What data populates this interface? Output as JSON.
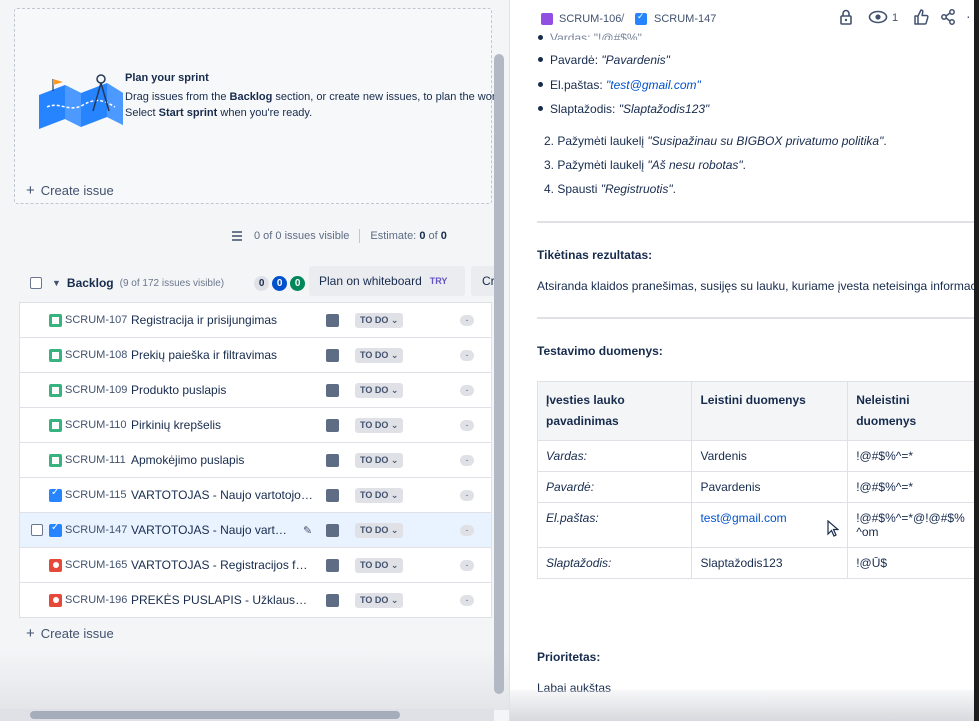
{
  "sprint_empty": {
    "title": "Plan your sprint",
    "line1_a": "Drag issues from the ",
    "line1_b": "Backlog",
    "line1_c": " section, or create new issues, to plan the work for",
    "line2_a": "Select ",
    "line2_b": "Start sprint",
    "line2_c": " when you're ready."
  },
  "create_issue_label": "Create issue",
  "stats": {
    "visible": "0 of 0 issues visible",
    "estimate_label": "Estimate:",
    "estimate_a": "0",
    "estimate_of": " of ",
    "estimate_b": "0"
  },
  "backlog": {
    "name": "Backlog",
    "count": "(9 of 172 issues visible)",
    "pill_grey": "0",
    "pill_blue": "0",
    "pill_green": "0",
    "plan_btn": "Plan on whiteboard",
    "plan_try": "TRY",
    "create_sprint_btn": "Cr",
    "status_label": "TO DO",
    "status_chevron": "⌄",
    "dash": "-",
    "rows": [
      {
        "type": "story",
        "key": "SCRUM-107",
        "summary": "Registracija ir prisijungimas"
      },
      {
        "type": "story",
        "key": "SCRUM-108",
        "summary": "Prekių paieška ir filtravimas"
      },
      {
        "type": "story",
        "key": "SCRUM-109",
        "summary": "Produkto puslapis"
      },
      {
        "type": "story",
        "key": "SCRUM-110",
        "summary": "Pirkinių krepšelis"
      },
      {
        "type": "story",
        "key": "SCRUM-111",
        "summary": "Apmokėjimo puslapis"
      },
      {
        "type": "task",
        "key": "SCRUM-115",
        "summary": "VARTOTOJAS - Naujo vartotojo re..."
      },
      {
        "type": "task",
        "key": "SCRUM-147",
        "summary": "VARTOTOJAS - Naujo vartot..."
      },
      {
        "type": "bug",
        "key": "SCRUM-165",
        "summary": "VARTOTOJAS - Registracijos form..."
      },
      {
        "type": "bug",
        "key": "SCRUM-196",
        "summary": "PREKĖS PUSLAPIS - Užklausa dėl ..."
      }
    ]
  },
  "detail": {
    "breadcrumb_parent": "SCRUM-106",
    "breadcrumb_sep": "/",
    "breadcrumb_current": "SCRUM-147",
    "watch_count": "1",
    "icons": [
      "lock-icon",
      "eye-icon",
      "thumbs-up-icon",
      "share-icon",
      "more-icon"
    ],
    "cut_bullet": "Vardas: \"!@#$%\"",
    "bullets": [
      {
        "label": "Pavardė: ",
        "value": "\"Pavardenis\"",
        "link": false
      },
      {
        "label": "El.paštas: ",
        "value": "\"test@gmail.com\"",
        "link": true
      },
      {
        "label": "Slaptažodis: ",
        "value": "\"Slaptažodis123\"",
        "link": false
      }
    ],
    "steps": [
      {
        "text": "2. Pažymėti laukelį ",
        "ital": "\"Susipažinau su BIGBOX privatumo politika\"",
        "end": "."
      },
      {
        "text": "3. Pažymėti laukelį ",
        "ital": "\"Aš nesu robotas\"",
        "end": "."
      },
      {
        "text": "4. Spausti ",
        "ital": "\"Registruotis\"",
        "end": "."
      }
    ],
    "expected_heading": "Tikėtinas rezultatas:",
    "expected_text": "Atsiranda klaidos pranešimas, susijęs su lauku, kuriame įvesta neteisinga informaci",
    "testdata_heading": "Testavimo duomenys:",
    "table": {
      "headers": [
        "Įvesties lauko pavadinimas",
        "Leistini duomenys",
        "Neleistini duomenys"
      ],
      "rows": [
        {
          "field": "Vardas:",
          "valid": "Vardenis",
          "invalid": "!@#$%^=*"
        },
        {
          "field": "Pavardė:",
          "valid": "Pavardenis",
          "invalid": "!@#$%^=*"
        },
        {
          "field": "El.paštas:",
          "valid": "test@gmail.com",
          "invalid": "!@#$%^=*@!@#$%^om"
        },
        {
          "field": "Slaptažodis:",
          "valid": "Slaptažodis123",
          "invalid": "!@Ū$"
        }
      ]
    },
    "priority_heading": "Prioritetas:",
    "priority_value": "Labai aukštas"
  }
}
